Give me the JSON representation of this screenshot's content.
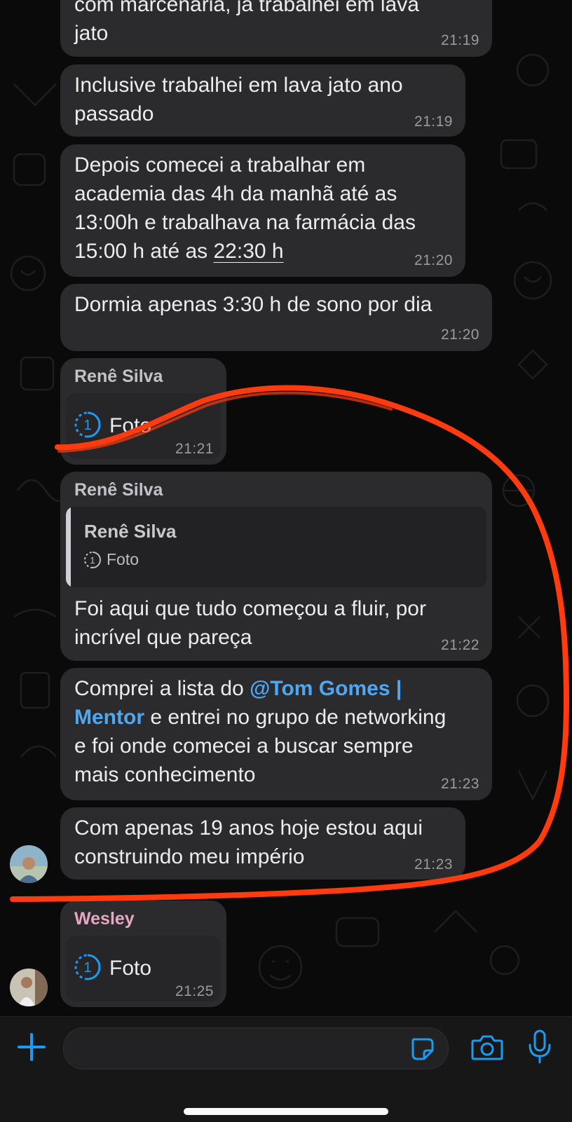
{
  "colors": {
    "bubble": "#2b2b2d",
    "accent": "#1d9bf0",
    "mention": "#4ea7f0",
    "annotation": "#ff3b0f",
    "wesley_name": "#e7a6c1"
  },
  "messages": [
    {
      "lines": [
        "com marcenaria, já trabalhei em lava",
        "jato"
      ],
      "time": "21:19"
    },
    {
      "lines": [
        "Inclusive trabalhei em lava jato ano",
        "passado"
      ],
      "time": "21:19"
    },
    {
      "lines": [
        "Depois comecei a trabalhar em",
        "academia das 4h da manhã até as",
        "13:00h e trabalhava na farmácia das",
        "15:00 h até as "
      ],
      "underlined": "22:30 h",
      "time": "21:20"
    },
    {
      "lines": [
        "Dormia apenas 3:30 h de sono por dia"
      ],
      "time": "21:20"
    },
    {
      "sender": "Renê Silva",
      "photo_label": "Foto",
      "view_once_count": "1",
      "time": "21:21"
    },
    {
      "sender": "Renê Silva",
      "quote": {
        "sender": "Renê Silva",
        "body": "Foto",
        "view_once_count": "1"
      },
      "lines": [
        "Foi aqui que tudo começou a fluir, por",
        "incrível que pareça"
      ],
      "time": "21:22"
    },
    {
      "line1_prefix": "Comprei a lista do ",
      "mention_part1": "@Tom Gomes |",
      "mention_part2": "Mentor",
      "line2_suffix": " e entrei no grupo de networking",
      "lines_rest": [
        "e foi onde comecei a buscar sempre",
        "mais conhecimento"
      ],
      "time": "21:23"
    },
    {
      "lines": [
        "Com apenas 19 anos hoje estou aqui",
        "construindo meu império"
      ],
      "time": "21:23"
    },
    {
      "sender": "Wesley",
      "photo_label": "Foto",
      "view_once_count": "1",
      "time": "21:25"
    }
  ],
  "input_bar": {
    "icons": [
      "plus-icon",
      "sticker-icon",
      "camera-icon",
      "microphone-icon"
    ]
  }
}
